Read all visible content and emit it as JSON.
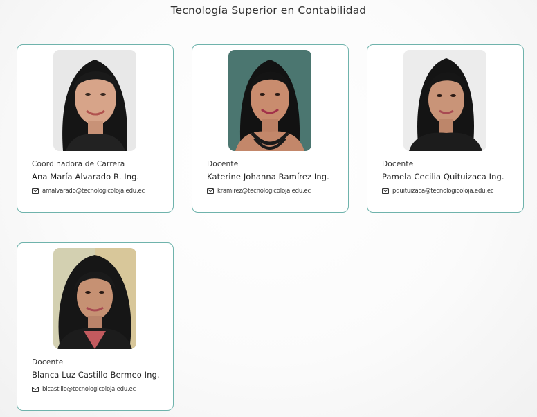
{
  "page_title": "Tecnología Superior en Contabilidad",
  "icon": "mail-icon",
  "staff": [
    {
      "role": "Coordinadora de Carrera",
      "name": "Ana María Alvarado R. Ing.",
      "email": "amalvarado@tecnologicoloja.edu.ec"
    },
    {
      "role": "Docente",
      "name": "Katerine Johanna Ramírez Ing.",
      "email": "kramirez@tecnologicoloja.edu.ec"
    },
    {
      "role": "Docente",
      "name": "Pamela Cecilia Quituizaca Ing.",
      "email": "pquituizaca@tecnologicoloja.edu.ec"
    },
    {
      "role": "Docente",
      "name": "Blanca Luz Castillo Bermeo Ing.",
      "email": "blcastillo@tecnologicoloja.edu.ec"
    }
  ]
}
